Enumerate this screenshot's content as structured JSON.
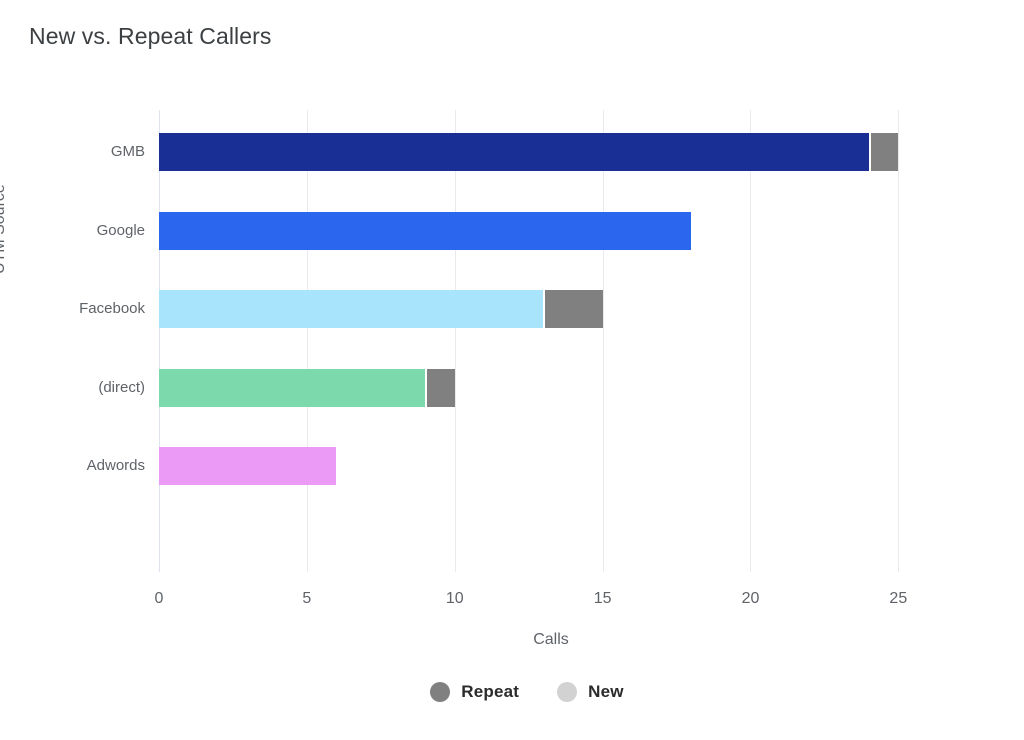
{
  "chart_data": {
    "type": "bar",
    "orientation": "horizontal",
    "stacked": true,
    "title": "New vs. Repeat Callers",
    "xlabel": "Calls",
    "ylabel": "UTM Source",
    "categories": [
      "GMB",
      "Google",
      "Facebook",
      "(direct)",
      "Adwords"
    ],
    "xlim": [
      0,
      25.8
    ],
    "xticks": [
      0,
      5,
      10,
      15,
      20,
      25
    ],
    "xtick_labels": [
      "0",
      "5",
      "10",
      "15",
      "20",
      "25"
    ],
    "grid": "vertical",
    "legend_position": "bottom-center",
    "series": [
      {
        "name": "New",
        "values": [
          24,
          18,
          13,
          9,
          6
        ],
        "note": "colored by UTM source",
        "colors": [
          "#1a2f96",
          "#2b66ef",
          "#a8e4fb",
          "#7bd9ab",
          "#eb9bf5"
        ]
      },
      {
        "name": "Repeat",
        "values": [
          1,
          0,
          2,
          1,
          0
        ],
        "color": "#808080"
      }
    ],
    "totals": [
      25,
      18,
      15,
      10,
      6
    ]
  },
  "header": {
    "title": "New vs. Repeat Callers"
  },
  "axes": {
    "x_title": "Calls",
    "y_title": "UTM Source",
    "x_ticks": [
      "0",
      "5",
      "10",
      "15",
      "20",
      "25"
    ],
    "y_categories": [
      "GMB",
      "Google",
      "Facebook",
      "(direct)",
      "Adwords"
    ]
  },
  "legend": {
    "items": [
      {
        "label": "Repeat",
        "color": "#808080"
      },
      {
        "label": "New",
        "color": "#d2d2d2"
      }
    ]
  },
  "colors": {
    "background": "#ffffff",
    "title_text": "#3c4043",
    "axis_text": "#5f6368",
    "gridline": "#e8eaed",
    "repeat_segment": "#808080",
    "gmb": "#1a2f96",
    "google": "#2b66ef",
    "facebook": "#a8e4fb",
    "direct": "#7bd9ab",
    "adwords": "#eb9bf5"
  }
}
